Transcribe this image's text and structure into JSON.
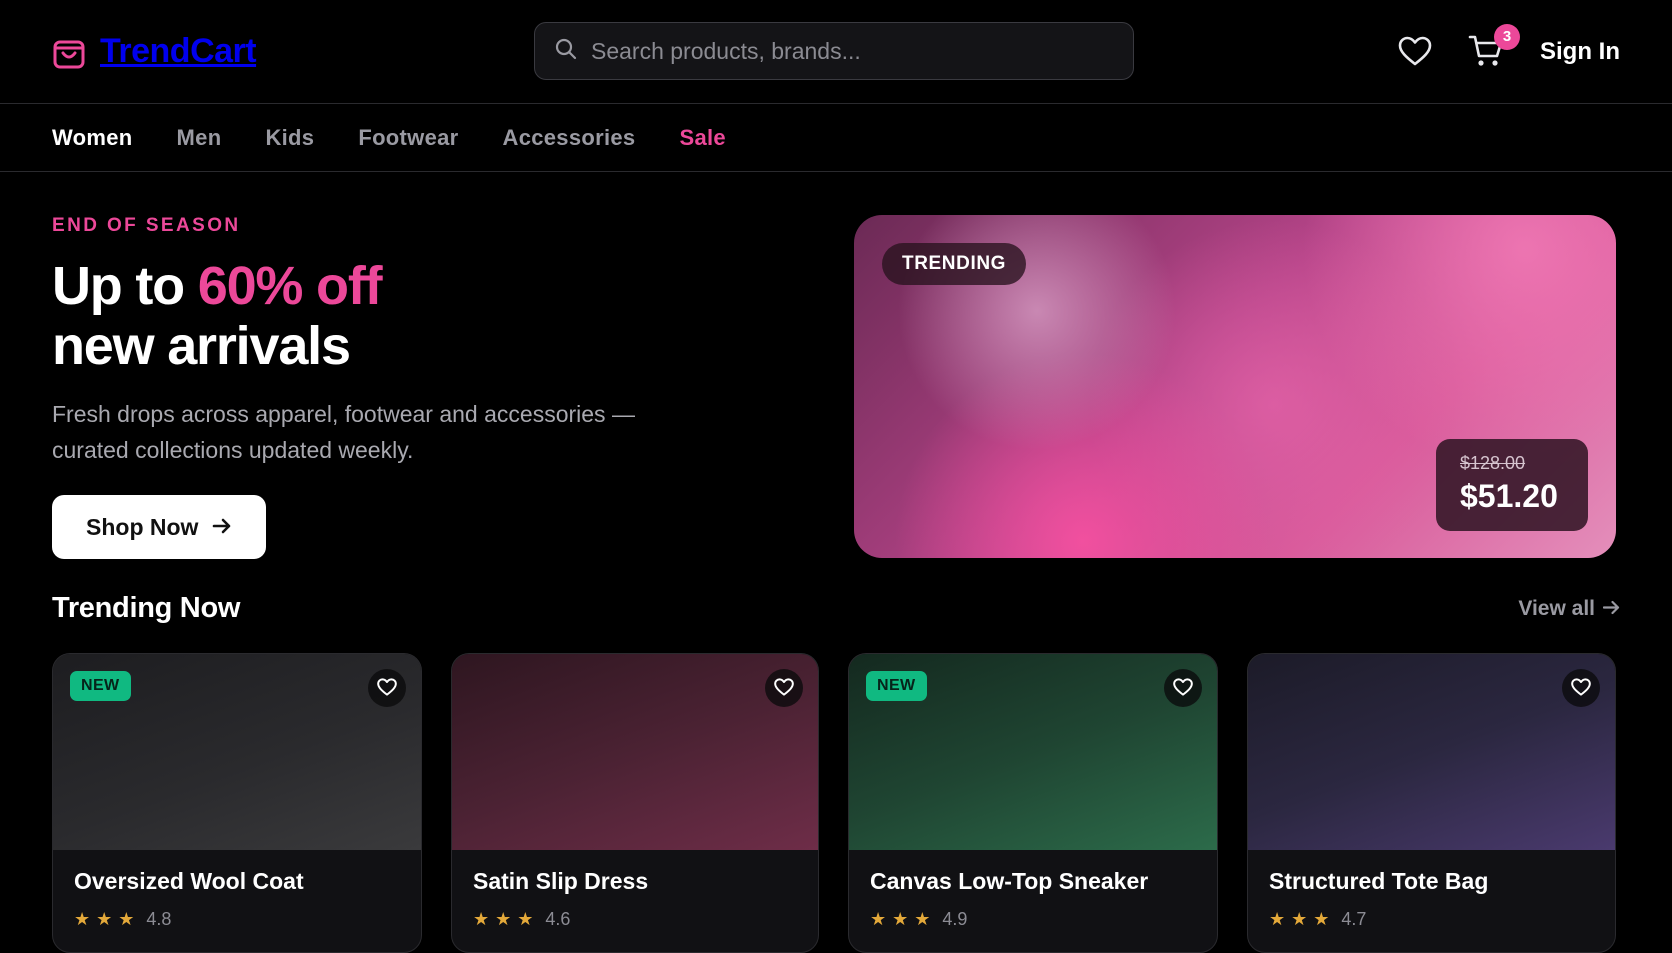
{
  "brand": {
    "name": "TrendCart",
    "accent": "#ec4899"
  },
  "search": {
    "placeholder": "Search products, brands...",
    "value": ""
  },
  "header": {
    "cart_count": "3",
    "sign_in": "Sign In"
  },
  "nav": {
    "items": [
      {
        "label": "Women",
        "state": "active"
      },
      {
        "label": "Men",
        "state": ""
      },
      {
        "label": "Kids",
        "state": ""
      },
      {
        "label": "Footwear",
        "state": ""
      },
      {
        "label": "Accessories",
        "state": ""
      },
      {
        "label": "Sale",
        "state": "sale"
      }
    ]
  },
  "hero": {
    "eyebrow": "END OF SEASON",
    "headline_pre": "Up to ",
    "headline_accent": "60% off",
    "headline_line2": "new arrivals",
    "subcopy": "Fresh drops across apparel, footwear and accessories — curated collections updated weekly.",
    "cta": "Shop Now",
    "promo": {
      "tag": "TRENDING",
      "old_price": "$128.00",
      "new_price": "$51.20"
    }
  },
  "trending": {
    "title": "Trending Now",
    "view_all": "View all",
    "products": [
      {
        "name": "Oversized Wool Coat",
        "rating": "4.8",
        "badge": "NEW"
      },
      {
        "name": "Satin Slip Dress",
        "rating": "4.6",
        "badge": ""
      },
      {
        "name": "Canvas Low-Top Sneaker",
        "rating": "4.9",
        "badge": "NEW"
      },
      {
        "name": "Structured Tote Bag",
        "rating": "4.7",
        "badge": ""
      }
    ]
  },
  "colors": {
    "background": "#000000",
    "accent": "#ec4899",
    "new_badge": "#10b981",
    "star": "#e4a93a"
  }
}
